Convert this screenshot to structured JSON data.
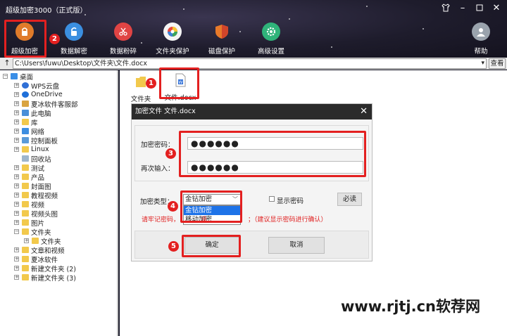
{
  "window": {
    "title": "超级加密3000（正式版）",
    "controls": [
      "shirt-icon",
      "minimize-icon",
      "maximize-icon",
      "close-icon"
    ]
  },
  "toolbar": {
    "items": [
      {
        "label": "超级加密",
        "icon": "lock-icon",
        "color": "#e07b2a"
      },
      {
        "label": "数据解密",
        "icon": "unlock-icon",
        "color": "#3b8fe0"
      },
      {
        "label": "数据粉碎",
        "icon": "scissors-icon",
        "color": "#e04444"
      },
      {
        "label": "文件夹保护",
        "icon": "aperture-icon",
        "color": "#f5f5f5"
      },
      {
        "label": "磁盘保护",
        "icon": "shield-icon",
        "color": "#e87a2a"
      },
      {
        "label": "高级设置",
        "icon": "gear-icon",
        "color": "#2fb37a"
      },
      {
        "label": "帮助",
        "icon": "user-icon",
        "color": "#9aa3ad"
      }
    ]
  },
  "annotations": [
    "1",
    "2",
    "3",
    "4",
    "5"
  ],
  "pathbar": {
    "up": "↑",
    "path": "C:\\Users\\fuwu\\Desktop\\文件夹\\文件.docx",
    "view_label": "查看"
  },
  "tree": {
    "root": "桌面",
    "items": [
      "WPS云盘",
      "OneDrive",
      "夏冰软件客服部",
      "此电脑",
      "库",
      "网络",
      "控制面板",
      "Linux",
      "回收站",
      "测试",
      "产品",
      "封面图",
      "教程视频",
      "视频",
      "视频头图",
      "图片",
      "文件夹",
      "文件夹",
      "文章和视频",
      "夏冰软件",
      "新建文件夹 (2)",
      "新建文件夹 (3)"
    ]
  },
  "files": [
    {
      "name": "文件夹",
      "icon": "folder-icon"
    },
    {
      "name": "文件.docx",
      "icon": "word-doc-icon"
    }
  ],
  "dialog": {
    "title": "加密文件 文件.docx",
    "password_label": "加密密码：",
    "password_value": "●●●●●●",
    "confirm_label": "再次输入：",
    "confirm_value": "●●●●●●",
    "type_label": "加密类型：",
    "type_selected": "金钻加密",
    "type_options": [
      "金钻加密",
      "移动加密"
    ],
    "show_password_label": "显示密码",
    "must_read_label": "必读",
    "warning_left": "请牢记密码，",
    "warning_mid": "没",
    "warning_right": "；（建议显示密码进行确认）",
    "ok_label": "确定",
    "cancel_label": "取消"
  },
  "watermark": "www.rjtj.cn软荐网",
  "colors": {
    "accent": "#e32020",
    "selection": "#1e73e8"
  }
}
